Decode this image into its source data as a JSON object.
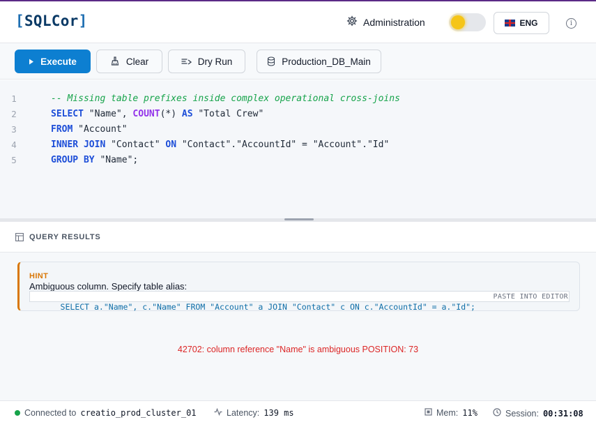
{
  "header": {
    "logo_bracket_open": "[",
    "logo_text": "SQLCor",
    "logo_bracket_close": "]",
    "admin_label": "Administration",
    "language": "ENG"
  },
  "toolbar": {
    "execute_label": "Execute",
    "clear_label": "Clear",
    "dry_run_label": "Dry Run",
    "database": "Production_DB_Main"
  },
  "editor": {
    "line_numbers": [
      "1",
      "2",
      "3",
      "4",
      "5"
    ],
    "lines": [
      "-- Missing table prefixes inside complex operational cross-joins",
      "SELECT \"Name\", COUNT(*) AS \"Total Crew\"",
      "FROM \"Account\"",
      "INNER JOIN \"Contact\" ON \"Contact\".\"AccountId\" = \"Account\".\"Id\"",
      "GROUP BY \"Name\";"
    ]
  },
  "results": {
    "title": "QUERY RESULTS",
    "hint": {
      "label": "HINT",
      "message": "Ambiguous column. Specify table alias:",
      "suggestion": "SELECT a.\"Name\", c.\"Name\" FROM \"Account\" a JOIN \"Contact\" c ON c.\"AccountId\" = a.\"Id\";",
      "paste_label": "PASTE INTO EDITOR"
    },
    "error": "42702: column reference \"Name\" is ambiguous POSITION: 73"
  },
  "status": {
    "connected_label": "Connected to",
    "cluster": "creatio_prod_cluster_01",
    "latency_label": "Latency:",
    "latency_value": "139 ms",
    "mem_label": "Mem:",
    "mem_value": "11%",
    "session_label": "Session:",
    "session_value": "00:31:08"
  },
  "colors": {
    "accent": "#0d7fd1",
    "logo": "#1f6fb2",
    "hint_border": "#d97706",
    "error": "#dc2626",
    "status_ok": "#16a34a"
  },
  "icons": [
    "gear-icon",
    "sun-icon",
    "flag-uk-icon",
    "info-icon",
    "play-icon",
    "broom-icon",
    "dry-run-icon",
    "database-icon",
    "table-icon",
    "activity-icon",
    "memory-icon",
    "clock-icon"
  ]
}
